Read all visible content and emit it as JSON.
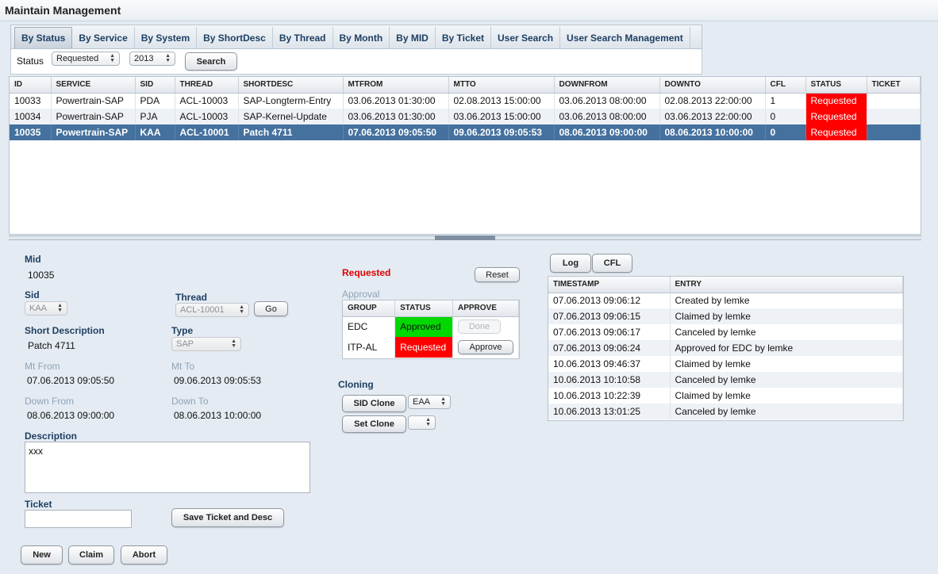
{
  "page": {
    "title": "Maintain Management"
  },
  "tabs": [
    "By Status",
    "By Service",
    "By System",
    "By ShortDesc",
    "By Thread",
    "By Month",
    "By MID",
    "By Ticket",
    "User Search",
    "User Search Management"
  ],
  "filter": {
    "status_label": "Status",
    "status_value": "Requested",
    "year_value": "2013",
    "search_label": "Search"
  },
  "grid": {
    "columns": [
      "ID",
      "SERVICE",
      "SID",
      "THREAD",
      "SHORTDESC",
      "MTFROM",
      "MTTO",
      "DOWNFROM",
      "DOWNTO",
      "CFL",
      "STATUS",
      "TICKET"
    ],
    "rows": [
      [
        "10033",
        "Powertrain-SAP",
        "PDA",
        "ACL-10003",
        "SAP-Longterm-Entry",
        "03.06.2013 01:30:00",
        "02.08.2013 15:00:00",
        "03.06.2013 08:00:00",
        "02.08.2013 22:00:00",
        "1",
        "Requested",
        ""
      ],
      [
        "10034",
        "Powertrain-SAP",
        "PJA",
        "ACL-10003",
        "SAP-Kernel-Update",
        "03.06.2013 01:30:00",
        "03.06.2013 15:00:00",
        "03.06.2013 08:00:00",
        "03.06.2013 22:00:00",
        "0",
        "Requested",
        ""
      ],
      [
        "10035",
        "Powertrain-SAP",
        "KAA",
        "ACL-10001",
        "Patch 4711",
        "07.06.2013 09:05:50",
        "09.06.2013 09:05:53",
        "08.06.2013 09:00:00",
        "08.06.2013 10:00:00",
        "0",
        "Requested",
        ""
      ]
    ]
  },
  "detail": {
    "mid_label": "Mid",
    "mid_value": "10035",
    "sid_label": "Sid",
    "sid_value": "KAA",
    "thread_label": "Thread",
    "thread_value": "ACL-10001",
    "go_label": "Go",
    "shortdesc_label": "Short Description",
    "shortdesc_value": "Patch 4711",
    "type_label": "Type",
    "type_value": "SAP",
    "mtfrom_label": "Mt From",
    "mtfrom_value": "07.06.2013 09:05:50",
    "mtto_label": "Mt To",
    "mtto_value": "09.06.2013 09:05:53",
    "downfrom_label": "Down From",
    "downfrom_value": "08.06.2013 09:00:00",
    "downto_label": "Down To",
    "downto_value": "08.06.2013 10:00:00",
    "description_label": "Description",
    "description_value": "xxx",
    "ticket_label": "Ticket",
    "ticket_value": "",
    "save_label": "Save Ticket and Desc",
    "new_label": "New",
    "claim_label": "Claim",
    "abort_label": "Abort"
  },
  "approval": {
    "status_text": "Requested",
    "reset_label": "Reset",
    "section_label": "Approval",
    "columns": [
      "GROUP",
      "STATUS",
      "APPROVE"
    ],
    "rows": [
      {
        "group": "EDC",
        "status": "Approved",
        "action": "Done"
      },
      {
        "group": "ITP-AL",
        "status": "Requested",
        "action": "Approve"
      }
    ]
  },
  "cloning": {
    "label": "Cloning",
    "sid_clone_label": "SID Clone",
    "sid_clone_value": "EAA",
    "set_clone_label": "Set Clone",
    "set_clone_value": ""
  },
  "log": {
    "tab_log": "Log",
    "tab_cfl": "CFL",
    "columns": [
      "TIMESTAMP",
      "ENTRY"
    ],
    "rows": [
      [
        "07.06.2013 09:06:12",
        "Created by lemke"
      ],
      [
        "07.06.2013 09:06:15",
        "Claimed by lemke"
      ],
      [
        "07.06.2013 09:06:17",
        "Canceled by lemke"
      ],
      [
        "07.06.2013 09:06:24",
        "Approved for EDC by lemke"
      ],
      [
        "10.06.2013 09:46:37",
        "Claimed by lemke"
      ],
      [
        "10.06.2013 10:10:58",
        "Canceled by lemke"
      ],
      [
        "10.06.2013 10:22:39",
        "Claimed by lemke"
      ],
      [
        "10.06.2013 13:01:25",
        "Canceled by lemke"
      ]
    ]
  },
  "colors": {
    "requested": "#ff0000",
    "approved": "#00d800",
    "selected_row": "#44719e",
    "label": "#1f3f63"
  }
}
